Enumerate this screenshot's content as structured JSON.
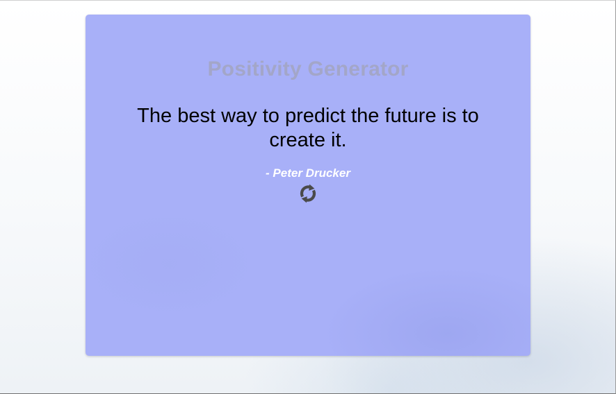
{
  "app": {
    "title": "Positivity Generator"
  },
  "quote": {
    "text": "The best way to predict the future is to create it.",
    "author": "- Peter Drucker"
  },
  "controls": {
    "refresh_icon": "sync-icon"
  },
  "colors": {
    "card_background": "#a8b0f8",
    "title": "#a3a6c8",
    "quote_text": "#000000",
    "author_text": "#ffffff",
    "icon": "#4a4a4a"
  }
}
